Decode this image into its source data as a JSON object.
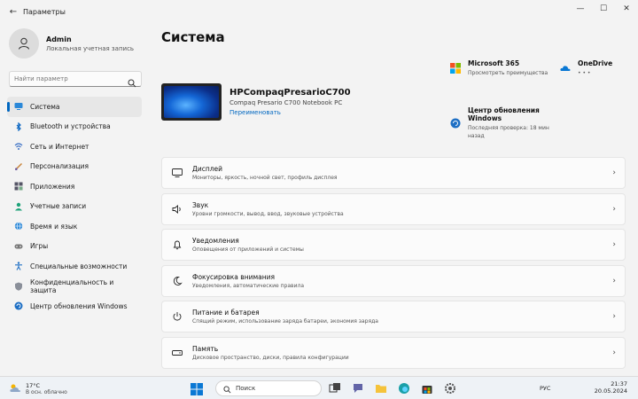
{
  "window": {
    "title": "Параметры"
  },
  "user": {
    "name": "Admin",
    "account_type": "Локальная учетная запись"
  },
  "search": {
    "placeholder": "Найти параметр"
  },
  "sidebar": {
    "items": [
      {
        "label": "Система",
        "icon": "monitor-icon"
      },
      {
        "label": "Bluetooth и устройства",
        "icon": "bluetooth-icon"
      },
      {
        "label": "Сеть и Интернет",
        "icon": "network-icon"
      },
      {
        "label": "Персонализация",
        "icon": "brush-icon"
      },
      {
        "label": "Приложения",
        "icon": "apps-icon"
      },
      {
        "label": "Учетные записи",
        "icon": "person-icon"
      },
      {
        "label": "Время и язык",
        "icon": "globe-icon"
      },
      {
        "label": "Игры",
        "icon": "gamepad-icon"
      },
      {
        "label": "Специальные возможности",
        "icon": "accessibility-icon"
      },
      {
        "label": "Конфиденциальность и защита",
        "icon": "shield-icon"
      },
      {
        "label": "Центр обновления Windows",
        "icon": "update-icon"
      }
    ]
  },
  "main": {
    "title": "Система",
    "device": {
      "name": "HPCompaqPresarioC700",
      "model": "Compaq Presario C700 Notebook PC",
      "rename_label": "Переименовать"
    },
    "promos": [
      {
        "title": "Microsoft 365",
        "subtitle": "Просмотреть преимущества"
      },
      {
        "title": "OneDrive",
        "subtitle": "• • •"
      },
      {
        "title": "Центр обновления Windows",
        "subtitle": "Последняя проверка: 18 мин назад"
      }
    ],
    "cards": [
      {
        "title": "Дисплей",
        "subtitle": "Мониторы, яркость, ночной свет, профиль дисплея",
        "icon": "display-icon"
      },
      {
        "title": "Звук",
        "subtitle": "Уровни громкости, вывод, ввод, звуковые устройства",
        "icon": "speaker-icon"
      },
      {
        "title": "Уведомления",
        "subtitle": "Оповещения от приложений и системы",
        "icon": "bell-icon"
      },
      {
        "title": "Фокусировка внимания",
        "subtitle": "Уведомления, автоматические правила",
        "icon": "focus-icon"
      },
      {
        "title": "Питание и батарея",
        "subtitle": "Спящий режим, использование заряда батареи, экономия заряда",
        "icon": "power-icon"
      },
      {
        "title": "Память",
        "subtitle": "Дисковое пространство, диски, правила конфигурации",
        "icon": "storage-icon"
      }
    ]
  },
  "taskbar": {
    "weather": {
      "temp": "17°C",
      "desc": "В осн. облачно"
    },
    "search_label": "Поиск",
    "lang": "РУС",
    "time": "21:37",
    "date": "20.05.2024"
  },
  "colors": {
    "accent": "#0067c0",
    "background": "#f3f3f3",
    "card": "#fbfbfb"
  }
}
